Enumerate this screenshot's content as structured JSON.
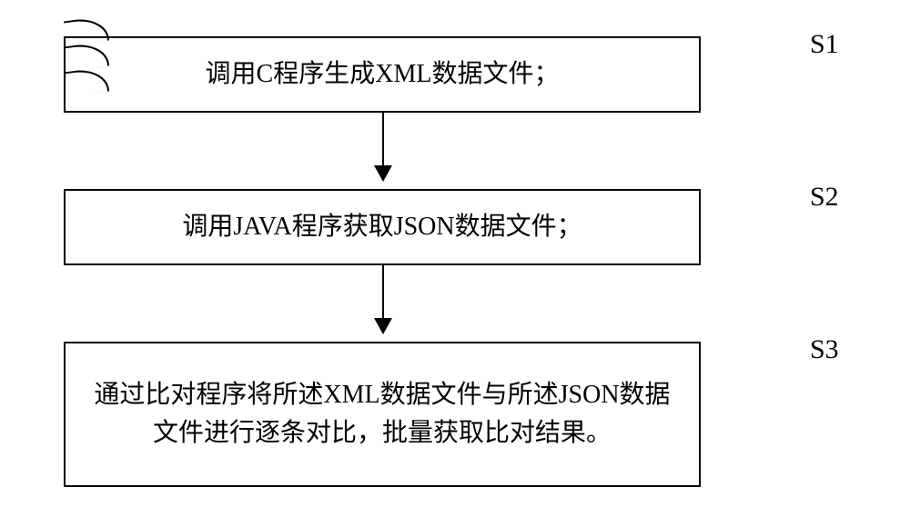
{
  "diagram": {
    "type": "flowchart",
    "steps": [
      {
        "id": "S1",
        "label": "S1",
        "text": "调用C程序生成XML数据文件；"
      },
      {
        "id": "S2",
        "label": "S2",
        "text": "调用JAVA程序获取JSON数据文件；"
      },
      {
        "id": "S3",
        "label": "S3",
        "text": "通过比对程序将所述XML数据文件与所述JSON数据文件进行逐条对比，批量获取比对结果。"
      }
    ]
  }
}
